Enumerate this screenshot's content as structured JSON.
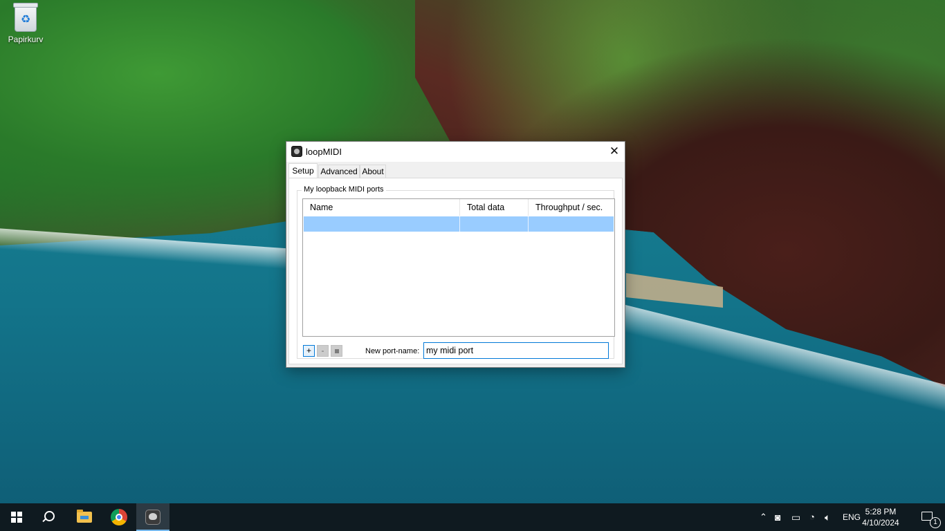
{
  "desktop": {
    "icons": [
      {
        "label": "Papirkurv",
        "icon": "recycle-bin-icon"
      }
    ]
  },
  "window": {
    "title": "loopMIDI",
    "close_glyph": "✕",
    "tabs": [
      {
        "label": "Setup",
        "active": true
      },
      {
        "label": "Advanced",
        "active": false
      },
      {
        "label": "About",
        "active": false
      }
    ],
    "setup": {
      "group_label": "My loopback MIDI ports",
      "columns": [
        "Name",
        "Total data",
        "Throughput / sec."
      ],
      "rows": [
        {
          "name": "",
          "total_data": "",
          "throughput": "",
          "selected": true
        }
      ],
      "buttons": {
        "add_label": "+",
        "remove_label": "-"
      },
      "new_port_label": "New port-name:",
      "new_port_value": "my midi port"
    }
  },
  "taskbar": {
    "pinned": [
      "start-icon",
      "search-icon",
      "file-explorer-icon",
      "chrome-icon",
      "loopmidi-icon"
    ],
    "active_app": "loopMIDI",
    "tray": {
      "chevron": "^",
      "language": "ENG",
      "time": "5:28 PM",
      "date": "4/10/2024",
      "notification_count": "1"
    }
  },
  "colors": {
    "selection": "#99ccff",
    "focus_border": "#0078d7",
    "taskbar": "#0f1a20"
  }
}
